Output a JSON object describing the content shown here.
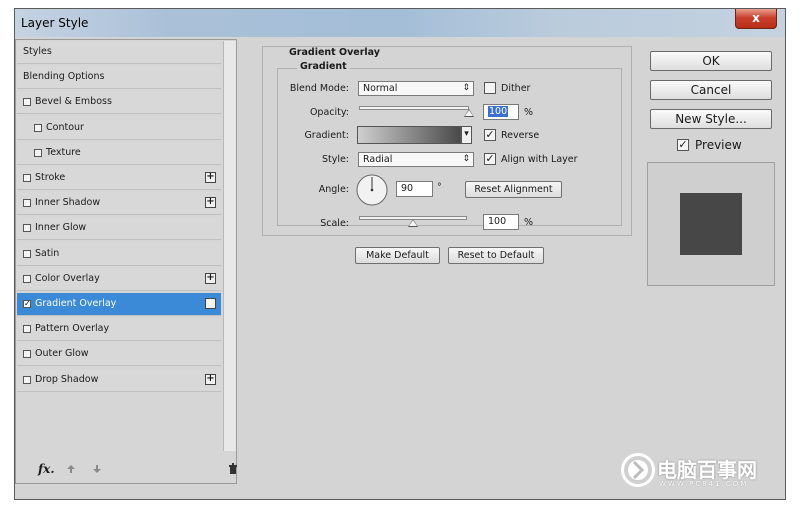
{
  "window": {
    "title": "Layer Style",
    "close_glyph": "x"
  },
  "left_panel": {
    "items": [
      {
        "label": "Styles",
        "checkbox": false,
        "plus": false,
        "indent": false,
        "selected": false
      },
      {
        "label": "Blending Options",
        "checkbox": false,
        "plus": false,
        "indent": false,
        "selected": false
      },
      {
        "label": "Bevel & Emboss",
        "checkbox": true,
        "plus": false,
        "indent": false,
        "selected": false
      },
      {
        "label": "Contour",
        "checkbox": true,
        "plus": false,
        "indent": true,
        "selected": false
      },
      {
        "label": "Texture",
        "checkbox": true,
        "plus": false,
        "indent": true,
        "selected": false
      },
      {
        "label": "Stroke",
        "checkbox": true,
        "plus": true,
        "indent": false,
        "selected": false
      },
      {
        "label": "Inner Shadow",
        "checkbox": true,
        "plus": true,
        "indent": false,
        "selected": false
      },
      {
        "label": "Inner Glow",
        "checkbox": true,
        "plus": false,
        "indent": false,
        "selected": false
      },
      {
        "label": "Satin",
        "checkbox": true,
        "plus": false,
        "indent": false,
        "selected": false
      },
      {
        "label": "Color Overlay",
        "checkbox": true,
        "plus": true,
        "indent": false,
        "selected": false
      },
      {
        "label": "Gradient Overlay",
        "checkbox": true,
        "plus": true,
        "indent": false,
        "selected": true,
        "checked": true
      },
      {
        "label": "Pattern Overlay",
        "checkbox": true,
        "plus": false,
        "indent": false,
        "selected": false
      },
      {
        "label": "Outer Glow",
        "checkbox": true,
        "plus": false,
        "indent": false,
        "selected": false
      },
      {
        "label": "Drop Shadow",
        "checkbox": true,
        "plus": true,
        "indent": false,
        "selected": false
      }
    ],
    "footer": {
      "fx_label": "fx",
      "fx_dot": "."
    }
  },
  "gradient_overlay": {
    "section_title": "Gradient Overlay",
    "group_title": "Gradient",
    "blend_mode_label": "Blend Mode:",
    "blend_mode_value": "Normal",
    "dither_label": "Dither",
    "dither_checked": false,
    "opacity_label": "Opacity:",
    "opacity_value": "100",
    "opacity_level": 1.0,
    "percent": "%",
    "gradient_label": "Gradient:",
    "reverse_label": "Reverse",
    "reverse_checked": true,
    "style_label": "Style:",
    "style_value": "Radial",
    "align_label": "Align with Layer",
    "align_checked": true,
    "angle_label": "Angle:",
    "angle_value": "90",
    "degree": "°",
    "reset_alignment": "Reset Alignment",
    "scale_label": "Scale:",
    "scale_value": "100",
    "scale_level": 0.5,
    "make_default": "Make Default",
    "reset_default": "Reset to Default"
  },
  "right": {
    "ok": "OK",
    "cancel": "Cancel",
    "new_style": "New Style...",
    "preview_label": "Preview",
    "preview_checked": true
  },
  "watermark": {
    "name": "电脑百事网",
    "url": "WWW.PC841.COM"
  },
  "colors": {
    "selection": "#3a8ad8",
    "preview_swatch": "#474747"
  },
  "check_glyph": "✓",
  "select_arrow": "⇕",
  "dropdown_arrow": "▾"
}
